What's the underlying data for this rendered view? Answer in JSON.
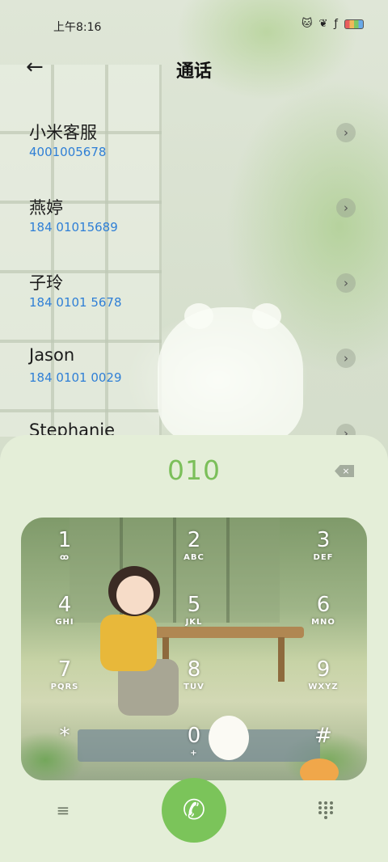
{
  "status_bar": {
    "time": "上午8:16",
    "icons": [
      "cat-icon",
      "leaf-icon",
      "wing-icon",
      "battery-icon"
    ]
  },
  "header": {
    "back_icon": "arrow-left-icon",
    "title": "通话"
  },
  "contacts": [
    {
      "name": "小米客服",
      "number": "4001005678"
    },
    {
      "name": "燕婷",
      "number": "184 01015689"
    },
    {
      "name": "子玲",
      "number": "184 0101 5678"
    },
    {
      "name": "Jason",
      "number": "184 0101 0029"
    },
    {
      "name": "Stephanie",
      "number": ""
    }
  ],
  "dialer": {
    "dialed_number": "010",
    "backspace_icon": "backspace-icon",
    "keys": [
      {
        "digit": "1",
        "letters": "ꝏ"
      },
      {
        "digit": "2",
        "letters": "ABC"
      },
      {
        "digit": "3",
        "letters": "DEF"
      },
      {
        "digit": "4",
        "letters": "GHI"
      },
      {
        "digit": "5",
        "letters": "JKL"
      },
      {
        "digit": "6",
        "letters": "MNO"
      },
      {
        "digit": "7",
        "letters": "PQRS"
      },
      {
        "digit": "8",
        "letters": "TUV"
      },
      {
        "digit": "9",
        "letters": "WXYZ"
      },
      {
        "digit": "*",
        "letters": ""
      },
      {
        "digit": "0",
        "letters": "+"
      },
      {
        "digit": "#",
        "letters": ""
      }
    ]
  },
  "bottom_bar": {
    "menu_icon": "menu-icon",
    "call_icon": "phone-icon",
    "keypad_icon": "keypad-grid-icon"
  },
  "colors": {
    "accent_green": "#7bc45a",
    "dialed_green": "#7bbf5a",
    "number_blue": "#2f7fd6"
  }
}
